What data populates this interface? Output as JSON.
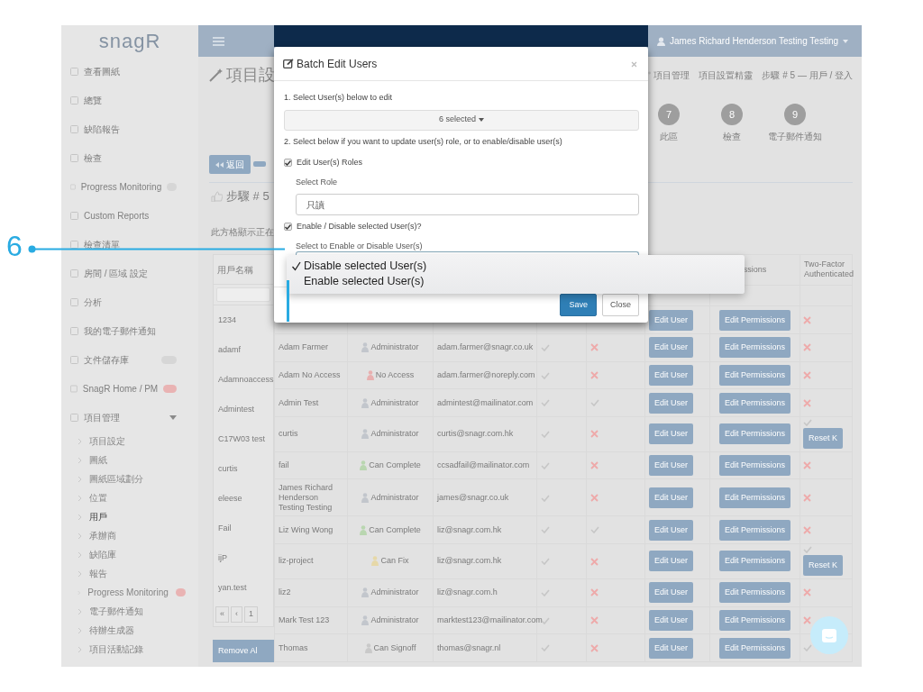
{
  "callout": {
    "number": "6"
  },
  "navbar": {
    "logo": "snagR",
    "user": "James Richard Henderson Testing Testing"
  },
  "sidebar": {
    "items": [
      {
        "label": "查看圖紙"
      },
      {
        "label": "總覽"
      },
      {
        "label": "缺陷報告"
      },
      {
        "label": "檢查"
      },
      {
        "label": "Progress Monitoring",
        "color": "#d6d6d6"
      },
      {
        "label": "Custom Reports"
      },
      {
        "label": "檢查清單"
      },
      {
        "label": "房間 / 區域 設定"
      },
      {
        "label": "分析"
      },
      {
        "label": "我的電子郵件通知"
      },
      {
        "label": "文件儲存庫",
        "color": "#d6d6d6"
      },
      {
        "label": "SnagR Home / PM",
        "color": "#e9b3b3"
      },
      {
        "label": "項目管理",
        "expanded": true,
        "children": [
          {
            "label": "項目設定",
            "selected": false
          },
          {
            "label": "圖紙",
            "selected": false
          },
          {
            "label": "圖紙區域劃分",
            "selected": false
          },
          {
            "label": "位置",
            "selected": false
          },
          {
            "label": "用戶",
            "selected": true
          },
          {
            "label": "承辦商",
            "selected": false
          },
          {
            "label": "缺陷庫",
            "selected": false
          },
          {
            "label": "報告",
            "selected": false
          },
          {
            "label": "Progress Monitoring",
            "selected": false,
            "color": "#e9b3b3"
          },
          {
            "label": "電子郵件通知",
            "selected": false
          },
          {
            "label": "待辦生成器",
            "selected": false
          },
          {
            "label": "項目活動記錄",
            "selected": false
          }
        ]
      }
    ]
  },
  "page": {
    "title": "項目設",
    "breadcrumb": [
      "項目管理",
      "項目設置精靈",
      "步驟 # 5 — 用戶 / 登入"
    ],
    "steps": [
      {
        "number": "7",
        "label": "此區"
      },
      {
        "number": "8",
        "label": "檢查"
      },
      {
        "number": "9",
        "label": "電子郵件通知"
      }
    ],
    "back_button": "返回",
    "step_heading": "步驟 # 5",
    "note": "此方格顯示正在"
  },
  "table": {
    "header": {
      "username": "用戶名稱",
      "permissions": "ssions",
      "two_factor": "Two-Factor Authenticated"
    },
    "usernames": [
      "1234",
      "adamf",
      "Adamnoaccess",
      "Admintest",
      "C17W03 test",
      "curtis",
      "eleese",
      "Fail",
      "ijP",
      "yan.test"
    ],
    "pager": [
      "«",
      "‹",
      "1"
    ],
    "rows": [
      {
        "edit_user": "Edit User",
        "edit_permissions": "Edit Permissions",
        "two_factor": false
      },
      {
        "name": "Adam Farmer",
        "role": {
          "label": "Administrator",
          "kind": "administrator"
        },
        "email": "adam.farmer@snagr.co.uk",
        "column_5": true,
        "column_6": false,
        "edit_user": "Edit User",
        "edit_permissions": "Edit Permissions",
        "two_factor": false
      },
      {
        "name": "Adam No Access",
        "role": {
          "label": "No Access",
          "kind": "no_access"
        },
        "email": "adam.farmer@noreply.com",
        "column_5": true,
        "column_6": false,
        "edit_user": "Edit User",
        "edit_permissions": "Edit Permissions",
        "two_factor": false
      },
      {
        "name": "Admin Test",
        "role": {
          "label": "Administrator",
          "kind": "administrator"
        },
        "email": "admintest@mailinator.com",
        "column_5": true,
        "column_6": true,
        "edit_user": "Edit User",
        "edit_permissions": "Edit Permissions",
        "two_factor": false
      },
      {
        "name": "curtis",
        "role": {
          "label": "Administrator",
          "kind": "administrator"
        },
        "email": "curtis@snagr.com.hk",
        "column_5": true,
        "column_6": false,
        "edit_user": "Edit User",
        "edit_permissions": "Edit Permissions",
        "two_factor": true,
        "reset_button": "Reset K"
      },
      {
        "name": "fail",
        "role": {
          "label": "Can Complete",
          "kind": "can_complete"
        },
        "email": "ccsadfail@mailinator.com",
        "column_5": true,
        "column_6": false,
        "edit_user": "Edit User",
        "edit_permissions": "Edit Permissions",
        "two_factor": false
      },
      {
        "name": "James Richard Henderson Testing Testing",
        "role": {
          "label": "Administrator",
          "kind": "administrator"
        },
        "email": "james@snagr.co.uk",
        "column_5": true,
        "column_6": false,
        "edit_user": "Edit User",
        "edit_permissions": "Edit Permissions",
        "two_factor": false
      },
      {
        "name": "Liz Wing Wong",
        "role": {
          "label": "Can Complete",
          "kind": "can_complete"
        },
        "email": "liz@snagr.com.hk",
        "column_5": true,
        "column_6": true,
        "edit_user": "Edit User",
        "edit_permissions": "Edit Permissions",
        "two_factor": false
      },
      {
        "name": "liz-project",
        "role": {
          "label": "Can Fix",
          "kind": "can_fix"
        },
        "email": "liz@snagr.com.hk",
        "column_5": true,
        "column_6": false,
        "edit_user": "Edit User",
        "edit_permissions": "Edit Permissions",
        "two_factor": true,
        "reset_button": "Reset K"
      },
      {
        "name": "liz2",
        "role": {
          "label": "Administrator",
          "kind": "administrator"
        },
        "email": "liz@snagr.com.h",
        "column_5": true,
        "column_6": false,
        "edit_user": "Edit User",
        "edit_permissions": "Edit Permissions",
        "two_factor": false
      },
      {
        "name": "Mark Test 123",
        "role": {
          "label": "Administrator",
          "kind": "administrator"
        },
        "email": "marktest123@mailinator.com",
        "column_5": true,
        "column_6": false,
        "edit_user": "Edit User",
        "edit_permissions": "Edit Permissions",
        "two_factor": false
      },
      {
        "name": "Thomas",
        "role": {
          "label": "Can Signoff",
          "kind": "can_signoff"
        },
        "email": "thomas@snagr.nl",
        "column_5": true,
        "column_6": false,
        "edit_user": "Edit User",
        "edit_permissions": "Edit Permissions",
        "two_factor": true
      }
    ],
    "remove_button": "Remove Al"
  },
  "modal": {
    "title": "Batch Edit Users",
    "step_1": "1. Select User(s) below to edit",
    "users_select": "6 selected",
    "step_2": "2. Select below if you want to update user(s) role, or to enable/disable user(s)",
    "roles_checkbox": {
      "label": "Edit User(s) Roles",
      "checked": true
    },
    "role_label": "Select Role",
    "role_value": "只讀",
    "enable_checkbox": {
      "label": "Enable / Disable selected User(s)?",
      "checked": true
    },
    "enable_label": "Select to Enable or Disable User(s)",
    "options": [
      {
        "label": "Disable selected User(s)",
        "selected": true
      },
      {
        "label": "Enable selected User(s)",
        "selected": false
      }
    ],
    "buttons": [
      {
        "label": "Save",
        "kind": "primary"
      },
      {
        "label": "Close",
        "kind": "default"
      }
    ]
  }
}
